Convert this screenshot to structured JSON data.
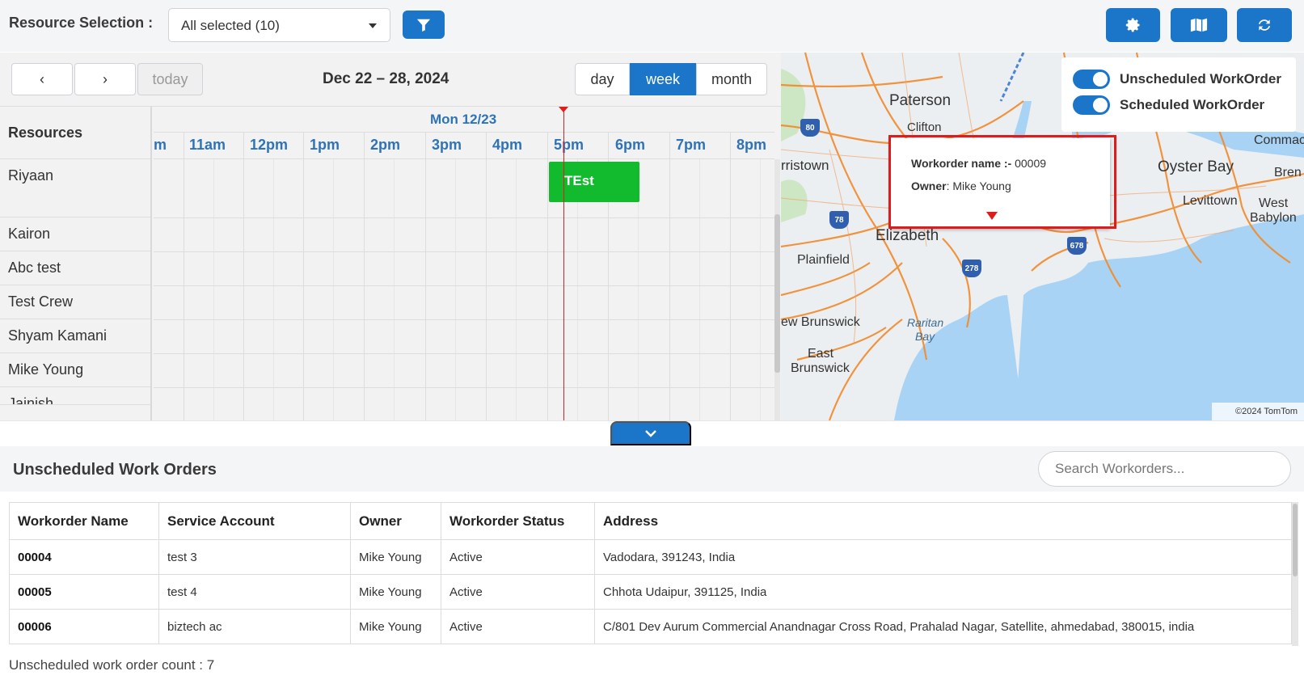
{
  "resource_selection": {
    "label": "Resource Selection :",
    "value": "All selected (10)"
  },
  "calendar": {
    "nav": {
      "prev": "‹",
      "next": "›",
      "today": "today"
    },
    "title": "Dec 22 – 28, 2024",
    "views": {
      "day": "day",
      "week": "week",
      "month": "month"
    },
    "resources_header": "Resources",
    "day_header": "Mon 12/23",
    "hours": [
      "m",
      "11am",
      "12pm",
      "1pm",
      "2pm",
      "3pm",
      "4pm",
      "5pm",
      "6pm",
      "7pm",
      "8pm"
    ],
    "resources": [
      "Riyaan",
      "Kairon",
      "Abc test",
      "Test Crew",
      "Shyam Kamani",
      "Mike Young",
      "Jainish"
    ],
    "event": {
      "title": "TEst",
      "color": "#12bb2e"
    }
  },
  "map": {
    "legend": {
      "unscheduled": "Unscheduled WorkOrder",
      "scheduled": "Scheduled WorkOrder"
    },
    "popup": {
      "name_label": "Workorder name :-",
      "name_value": "00009",
      "owner_label": "Owner",
      "owner_value": "Mike Young"
    },
    "labels": {
      "paterson": "Paterson",
      "clifton": "Clifton",
      "morristown": "rristown",
      "elizabeth": "Elizabeth",
      "plainfield": "Plainfield",
      "oyster_bay": "Oyster Bay",
      "levittown": "Levittown",
      "west_babylon_1": "West",
      "west_babylon_2": "Babylon",
      "commack": "Commac",
      "brent": "Bren",
      "new_brunswick": "ew Brunswick",
      "raritan_1": "Raritan",
      "raritan_2": "Bay",
      "east_brunswick_1": "East",
      "east_brunswick_2": "Brunswick"
    },
    "shields": {
      "i80": "80",
      "i78": "78",
      "i278": "278",
      "i678": "678"
    },
    "copyright": "©2024 TomTom"
  },
  "unscheduled": {
    "title": "Unscheduled Work Orders",
    "search_placeholder": "Search Workorders...",
    "columns": [
      "Workorder Name",
      "Service Account",
      "Owner",
      "Workorder Status",
      "Address"
    ],
    "rows": [
      [
        "00004",
        "test 3",
        "Mike Young",
        "Active",
        "Vadodara, 391243, India"
      ],
      [
        "00005",
        "test 4",
        "Mike Young",
        "Active",
        "Chhota Udaipur, 391125, India"
      ],
      [
        "00006",
        "biztech ac",
        "Mike Young",
        "Active",
        "C/801 Dev Aurum Commercial Anandnagar Cross Road, Prahalad Nagar, Satellite, ahmedabad, 380015, india"
      ]
    ],
    "count_text": "Unscheduled work order count : 7"
  },
  "colors": {
    "accent": "#1b75c8",
    "event": "#12bb2e",
    "now_line": "#e31b1b"
  }
}
